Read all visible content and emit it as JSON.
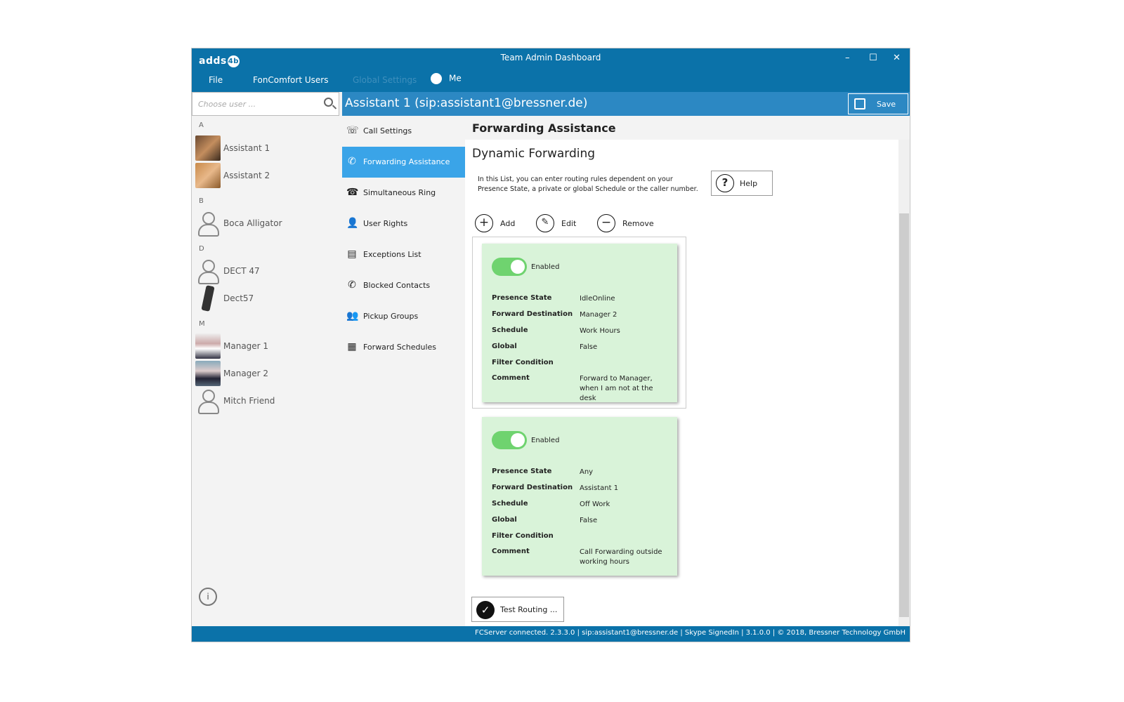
{
  "window": {
    "logo": "adds",
    "logo_badge": "4b",
    "title": "Team Admin Dashboard",
    "minimize": "–",
    "maximize": "☐",
    "close": "✕"
  },
  "menu": {
    "file": "File",
    "users": "FonComfort Users",
    "global": "Global Settings",
    "me": "Me"
  },
  "search": {
    "placeholder": "Choose user ..."
  },
  "users": [
    {
      "letter": "A"
    },
    {
      "name": "Assistant 1"
    },
    {
      "name": "Assistant 2"
    },
    {
      "letter": "B"
    },
    {
      "name": "Boca Alligator"
    },
    {
      "letter": "D"
    },
    {
      "name": "DECT 47"
    },
    {
      "name": "Dect57"
    },
    {
      "letter": "M"
    },
    {
      "name": "Manager 1"
    },
    {
      "name": "Manager 2"
    },
    {
      "name": "Mitch Friend"
    }
  ],
  "header": {
    "title": "Assistant 1 (sip:assistant1@bressner.de)",
    "save": "Save"
  },
  "nav": [
    "Call Settings",
    "Forwarding Assistance",
    "Simultaneous Ring",
    "User Rights",
    "Exceptions List",
    "Blocked Contacts",
    "Pickup Groups",
    "Forward Schedules"
  ],
  "main": {
    "section_title": "Forwarding Assistance",
    "subtitle": "Dynamic Forwarding",
    "description": "In this List, you can enter routing rules dependent on your Presence State, a private or global Schedule or the caller number.",
    "help": "Help",
    "add": "Add",
    "edit": "Edit",
    "remove": "Remove",
    "labels": {
      "presence": "Presence State",
      "dest": "Forward Destination",
      "schedule": "Schedule",
      "global": "Global",
      "filter": "Filter Condition",
      "comment": "Comment"
    },
    "rules": [
      {
        "enabled": "Enabled",
        "presence": "IdleOnline",
        "dest": "Manager 2",
        "schedule": "Work Hours",
        "global": "False",
        "filter": "",
        "comment": "Forward to Manager, when I am not at the desk"
      },
      {
        "enabled": "Enabled",
        "presence": "Any",
        "dest": "Assistant 1",
        "schedule": "Off Work",
        "global": "False",
        "filter": "",
        "comment": "Call Forwarding outside working hours"
      }
    ],
    "test_routing": "Test Routing ..."
  },
  "status": "FCServer connected. 2.3.3.0 | sip:assistant1@bressner.de  | Skype SignedIn | 3.1.0.0 | © 2018, Bressner Technology GmbH"
}
